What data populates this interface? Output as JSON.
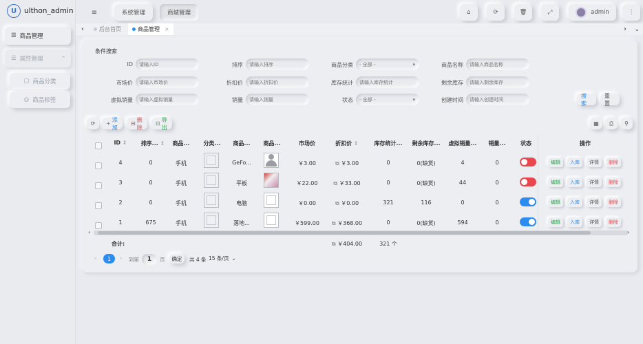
{
  "app": {
    "name": "ulthon_admin"
  },
  "sidebar": {
    "items": [
      {
        "label": "商品管理"
      },
      {
        "label": "属性管理"
      },
      {
        "label": "商品分类"
      },
      {
        "label": "商品标签"
      }
    ]
  },
  "header": {
    "menu_icon": "≡",
    "nav": [
      {
        "label": "系统管理"
      },
      {
        "label": "商城管理"
      }
    ],
    "user": "admin"
  },
  "tabs": [
    {
      "label": "后台首页"
    },
    {
      "label": "商品管理"
    }
  ],
  "filters": {
    "title": "条件搜索",
    "fields": [
      {
        "label": "ID",
        "placeholder": "请输入ID"
      },
      {
        "label": "排序",
        "placeholder": "请输入排序"
      },
      {
        "label": "商品分类",
        "placeholder": "- 全部 -"
      },
      {
        "label": "商品名称",
        "placeholder": "请输入商品名称"
      },
      {
        "label": "市场价",
        "placeholder": "请输入市场价"
      },
      {
        "label": "折扣价",
        "placeholder": "请输入折扣价"
      },
      {
        "label": "库存统计",
        "placeholder": "请输入库存统计"
      },
      {
        "label": "剩余库存",
        "placeholder": "请输入剩余库存"
      },
      {
        "label": "虚拟销量",
        "placeholder": "请输入虚拟销量"
      },
      {
        "label": "销量",
        "placeholder": "请输入销量"
      },
      {
        "label": "状态",
        "placeholder": "- 全部 -"
      },
      {
        "label": "创建时间",
        "placeholder": "请输入创建时间"
      }
    ],
    "search_label": "搜 索",
    "reset_label": "重 置"
  },
  "toolbar": {
    "add_label": "添加",
    "delete_label": "删除",
    "export_label": "导出"
  },
  "table": {
    "headers": [
      "ID",
      "排序...",
      "商品...",
      "分类...",
      "商品...",
      "商品...",
      "市场价",
      "折扣价",
      "库存统计...",
      "剩余库存...",
      "虚拟销量...",
      "销量...",
      "状态",
      "操作"
    ],
    "rows": [
      {
        "id": "4",
        "sort": "0",
        "cate": "手机",
        "title": "GeFo...",
        "market": "￥3.00",
        "discount": "￥3.00",
        "total": "0",
        "remain": "0(缺货)",
        "virtual": "4",
        "sales": "0",
        "status": false
      },
      {
        "id": "3",
        "sort": "0",
        "cate": "手机",
        "title": "平板",
        "market": "￥22.00",
        "discount": "￥33.00",
        "total": "0",
        "remain": "0(缺货)",
        "virtual": "44",
        "sales": "0",
        "status": false
      },
      {
        "id": "2",
        "sort": "0",
        "cate": "手机",
        "title": "电脑",
        "market": "￥0.00",
        "discount": "￥0.00",
        "total": "321",
        "remain": "116",
        "virtual": "0",
        "sales": "0",
        "status": true
      },
      {
        "id": "1",
        "sort": "675",
        "cate": "手机",
        "title": "落地...",
        "market": "￥599.00",
        "discount": "￥368.00",
        "total": "0",
        "remain": "0(缺货)",
        "virtual": "594",
        "sales": "0",
        "status": true
      }
    ],
    "actions": [
      "编辑",
      "入库",
      "详情",
      "删除"
    ],
    "total_label": "合计:",
    "total_discount": "￥404.00",
    "total_stock": "321 个"
  },
  "pagination": {
    "current": "1",
    "goto_label": "到第",
    "page_value": "1",
    "page_unit": "页",
    "confirm": "确定",
    "total": "共 4 条",
    "per_page": "15 条/页"
  },
  "colors": {
    "primary": "#2d8cf0",
    "danger": "#e8484d",
    "success": "#2ba24c",
    "toggle_off": "#e8484d",
    "toggle_on": "#2d8cf0"
  }
}
